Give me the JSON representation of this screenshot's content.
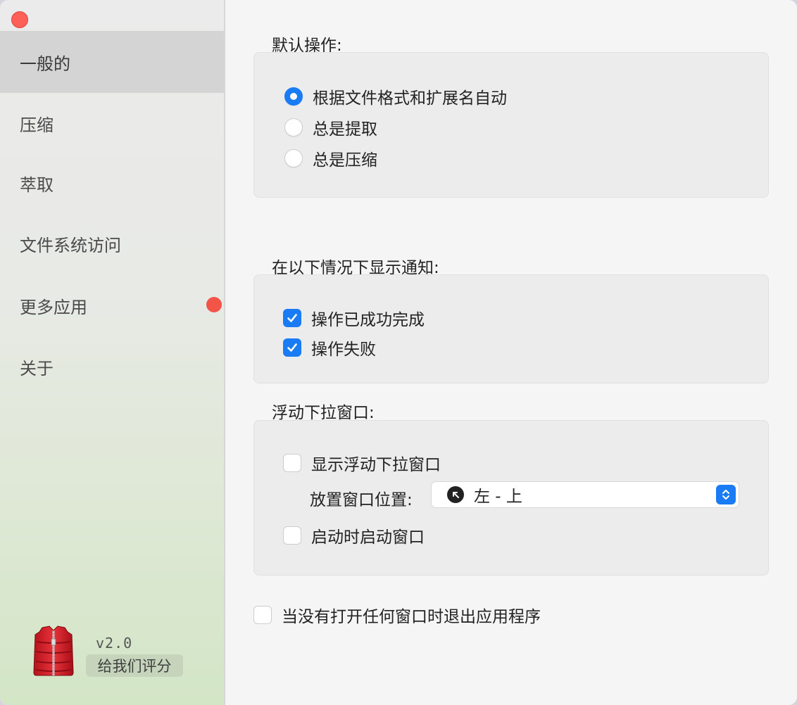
{
  "sidebar": {
    "items": [
      {
        "label": "一般的",
        "active": true
      },
      {
        "label": "压缩"
      },
      {
        "label": "萃取"
      },
      {
        "label": "文件系统访问"
      },
      {
        "label": "更多应用",
        "badge": "red-dot"
      },
      {
        "label": "关于"
      }
    ],
    "version": "v2.0",
    "rate_label": "给我们评分"
  },
  "default_action": {
    "title": "默认操作:",
    "options": [
      {
        "label": "根据文件格式和扩展名自动",
        "selected": true
      },
      {
        "label": "总是提取",
        "selected": false
      },
      {
        "label": "总是压缩",
        "selected": false
      }
    ]
  },
  "notifications": {
    "title": "在以下情况下显示通知:",
    "options": [
      {
        "label": "操作已成功完成",
        "checked": true
      },
      {
        "label": "操作失败",
        "checked": true
      }
    ]
  },
  "floating": {
    "title": "浮动下拉窗口:",
    "show_label": "显示浮动下拉窗口",
    "show_checked": false,
    "position_label": "放置窗口位置:",
    "position_value": "左 - 上",
    "launch_label": "启动时启动窗口",
    "launch_checked": false
  },
  "quit": {
    "label": "当没有打开任何窗口时退出应用程序",
    "checked": false
  },
  "colors": {
    "accent": "#1a7cf5",
    "close": "#fe5f57",
    "badge": "#f25547"
  }
}
